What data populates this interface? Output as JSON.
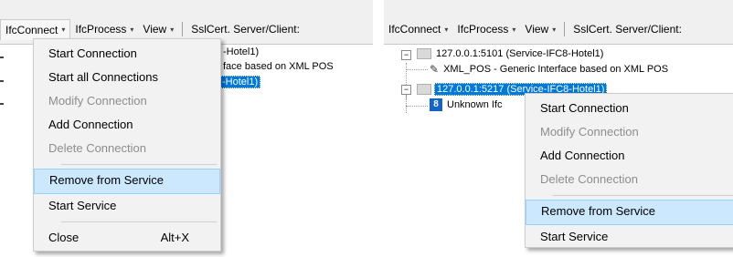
{
  "menubar": {
    "items": [
      {
        "label": "IfcConnect"
      },
      {
        "label": "IfcProcess"
      },
      {
        "label": "View"
      },
      {
        "label": "SslCert. Server/Client:"
      }
    ],
    "caret": "▾"
  },
  "left": {
    "tree_fragments": [
      "-Hotel1)",
      "face based on XML POS",
      "-Hotel1)"
    ],
    "menu": {
      "items": [
        {
          "label": "Start Connection",
          "enabled": true
        },
        {
          "label": "Start all Connections",
          "enabled": true
        },
        {
          "label": "Modify Connection",
          "enabled": false
        },
        {
          "label": "Add Connection",
          "enabled": true
        },
        {
          "label": "Delete Connection",
          "enabled": false
        },
        {
          "label": "Remove from Service",
          "enabled": true,
          "highlighted": true
        },
        {
          "label": "Start Service",
          "enabled": true
        },
        {
          "label": "Close",
          "enabled": true,
          "shortcut": "Alt+X"
        }
      ]
    }
  },
  "right": {
    "tree": [
      {
        "label": "127.0.0.1:5101 (Service-IFC8-Hotel1)",
        "icon": "server-icon"
      },
      {
        "label": "XML_POS - Generic Interface based on XML POS",
        "icon": "plug-icon"
      },
      {
        "label": "127.0.0.1:5217 (Service-IFC8-Hotel1)",
        "icon": "server-icon",
        "selected": true
      },
      {
        "label": "Unknown Ifc",
        "icon": "unknown-interface-icon",
        "icon_text": "8"
      }
    ],
    "expander_symbol": "−",
    "menu": {
      "items": [
        {
          "label": "Start Connection",
          "enabled": true
        },
        {
          "label": "Modify Connection",
          "enabled": false
        },
        {
          "label": "Add Connection",
          "enabled": true
        },
        {
          "label": "Delete Connection",
          "enabled": false
        },
        {
          "label": "Remove from Service",
          "enabled": true,
          "highlighted": true
        },
        {
          "label": "Start Service",
          "enabled": true
        }
      ]
    }
  },
  "colors": {
    "selection": "#0078d7",
    "menu_highlight": "#cce8ff",
    "menu_highlight_border": "#99d1ff",
    "disabled_text": "#8d8d8d"
  }
}
